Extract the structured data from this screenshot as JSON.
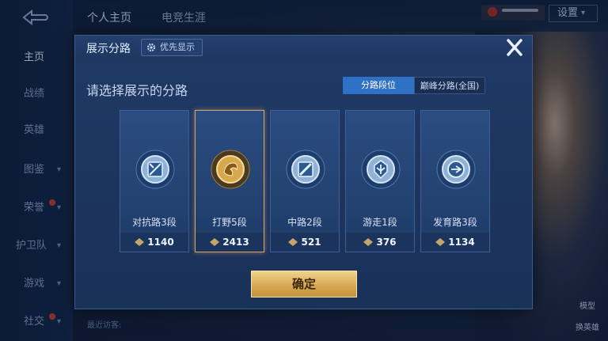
{
  "sidebar": {
    "items": [
      {
        "label": "主页",
        "active": true
      },
      {
        "label": "战绩"
      },
      {
        "label": "英雄"
      },
      {
        "label": "图鉴"
      },
      {
        "label": "荣誉"
      },
      {
        "label": "护卫队"
      },
      {
        "label": "游戏"
      },
      {
        "label": "社交"
      }
    ]
  },
  "topbar": {
    "tabs": [
      "个人主页",
      "电竞生涯"
    ],
    "settings_label": "设置"
  },
  "background": {
    "right_label": "模型",
    "switch_label": "换英雄",
    "recent_visitors": "最近访客:"
  },
  "modal": {
    "title": "展示分路",
    "priority_label": "优先显示",
    "select_title": "请选择展示的分路",
    "segments": [
      "分路段位",
      "巅峰分路(全国)"
    ],
    "cards": [
      {
        "name": "对抗路3段",
        "points": "1140",
        "icon": "clash-lane-emblem"
      },
      {
        "name": "打野5段",
        "points": "2413",
        "icon": "jungle-emblem",
        "selected": true
      },
      {
        "name": "中路2段",
        "points": "521",
        "icon": "mid-lane-emblem"
      },
      {
        "name": "游走1段",
        "points": "376",
        "icon": "roam-emblem"
      },
      {
        "name": "发育路3段",
        "points": "1134",
        "icon": "farm-lane-emblem"
      }
    ],
    "confirm_label": "确定"
  },
  "colors": {
    "accent_blue": "#2f71c4",
    "selected_gold": "#d9a46a",
    "confirm_gold": "#d8aa55"
  }
}
